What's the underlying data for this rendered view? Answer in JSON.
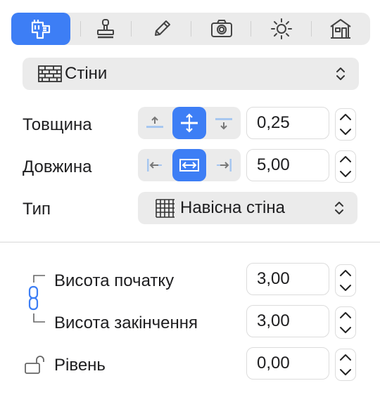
{
  "toolbar": {
    "tools": [
      {
        "name": "wall-tool-icon",
        "active": true
      },
      {
        "name": "stamp-icon",
        "active": false
      },
      {
        "name": "pencil-icon",
        "active": false
      },
      {
        "name": "camera-icon",
        "active": false
      },
      {
        "name": "sun-icon",
        "active": false
      },
      {
        "name": "house-icon",
        "active": false
      }
    ]
  },
  "element_type": {
    "label": "Стіни",
    "icon": "brick-wall-icon"
  },
  "thickness": {
    "label": "Товщина",
    "value": "0,25",
    "alignment": "center"
  },
  "length": {
    "label": "Довжина",
    "value": "5,00",
    "alignment": "center"
  },
  "type": {
    "label": "Тип",
    "value": "Навісна стіна",
    "icon": "curtain-wall-icon"
  },
  "height_start": {
    "label": "Висота початку",
    "value": "3,00"
  },
  "height_end": {
    "label": "Висота закінчення",
    "value": "3,00"
  },
  "level": {
    "label": "Рівень",
    "value": "0,00"
  },
  "colors": {
    "accent": "#3d7ef5",
    "control_bg": "#ebebeb",
    "icon_gray": "#555555"
  }
}
